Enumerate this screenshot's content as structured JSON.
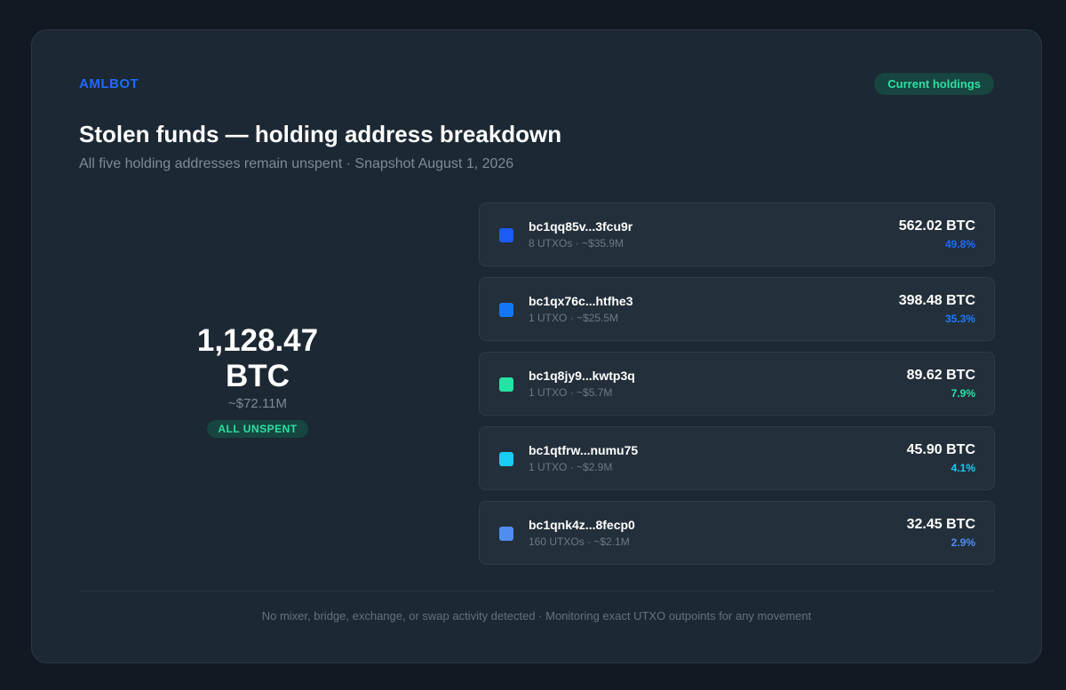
{
  "brand": "AMLBOT",
  "status_pill": "Current holdings",
  "title": "Stolen funds — holding address breakdown",
  "subtitle": "All five holding addresses remain unspent · Snapshot August 1, 2026",
  "total": {
    "amount_line1": "1,128.47",
    "amount_line2": "BTC",
    "usd": "~$72.11M",
    "badge": "ALL UNSPENT"
  },
  "addresses": [
    {
      "address": "bc1qq85v...3fcu9r",
      "meta": "8 UTXOs · ~$35.9M",
      "btc": "562.02 BTC",
      "pct": "49.8%",
      "color": "#1a5cf5",
      "pct_color": "#1f6bff"
    },
    {
      "address": "bc1qx76c...htfhe3",
      "meta": "1 UTXO · ~$25.5M",
      "btc": "398.48 BTC",
      "pct": "35.3%",
      "color": "#1477f2",
      "pct_color": "#1f7bff"
    },
    {
      "address": "bc1q8jy9...kwtp3q",
      "meta": "1 UTXO · ~$5.7M",
      "btc": "89.62 BTC",
      "pct": "7.9%",
      "color": "#25e3a4",
      "pct_color": "#2ce0a2"
    },
    {
      "address": "bc1qtfrw...numu75",
      "meta": "1 UTXO · ~$2.9M",
      "btc": "45.90 BTC",
      "pct": "4.1%",
      "color": "#18cdf2",
      "pct_color": "#1dc9ee"
    },
    {
      "address": "bc1qnk4z...8fecp0",
      "meta": "160 UTXOs · ~$2.1M",
      "btc": "32.45 BTC",
      "pct": "2.9%",
      "color": "#4f8ef0",
      "pct_color": "#4f8ef7"
    }
  ],
  "footer": "No mixer, bridge, exchange, or swap activity detected · Monitoring exact UTXO outpoints for any movement"
}
